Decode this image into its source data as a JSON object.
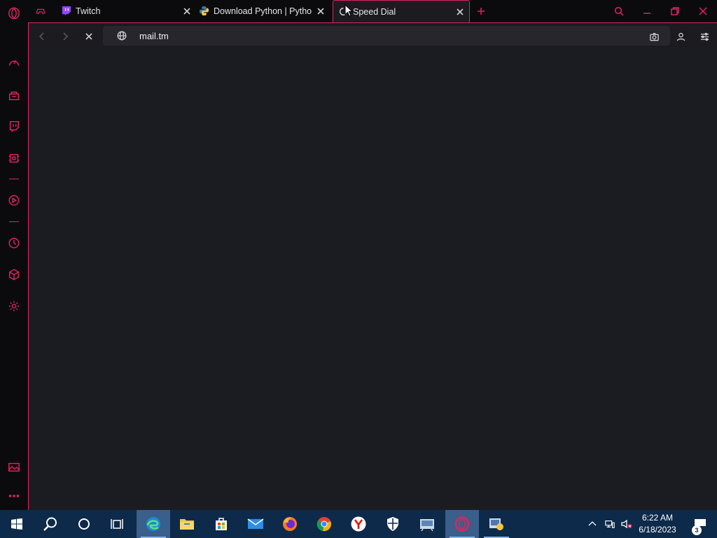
{
  "browser": {
    "accent_color": "#e0245e",
    "tabs": [
      {
        "title": "",
        "icon": "gamepad-icon",
        "active": false
      },
      {
        "title": "Twitch",
        "icon": "twitch-icon",
        "active": false
      },
      {
        "title": "Download Python | Python",
        "icon": "python-icon",
        "active": false
      },
      {
        "title": "Speed Dial",
        "icon": "loading-spinner-icon",
        "active": true
      }
    ],
    "address_bar": {
      "url": "mail.tm"
    }
  },
  "sidebar": {
    "items": [
      {
        "name": "opera-logo-icon"
      },
      {
        "name": "speed-dial-icon"
      },
      {
        "name": "shopping-bag-icon"
      },
      {
        "name": "twitch-icon"
      },
      {
        "name": "crypto-wallet-icon"
      },
      {
        "name": "player-icon"
      },
      {
        "name": "history-icon"
      },
      {
        "name": "extensions-icon"
      },
      {
        "name": "settings-icon"
      },
      {
        "name": "wallpaper-icon"
      },
      {
        "name": "more-icon"
      }
    ]
  },
  "taskbar": {
    "color": "#0d2a4a",
    "apps": [
      "windows-start-icon",
      "search-icon",
      "cortana-icon",
      "task-view-icon",
      "edge-icon",
      "file-explorer-icon",
      "microsoft-store-icon",
      "mail-icon",
      "firefox-icon",
      "chrome-icon",
      "yandex-icon",
      "security-icon",
      "control-panel-icon",
      "opera-gx-icon",
      "app-icon"
    ],
    "clock": {
      "time": "6:22 AM",
      "date": "6/18/2023"
    },
    "notification_count": "3"
  }
}
